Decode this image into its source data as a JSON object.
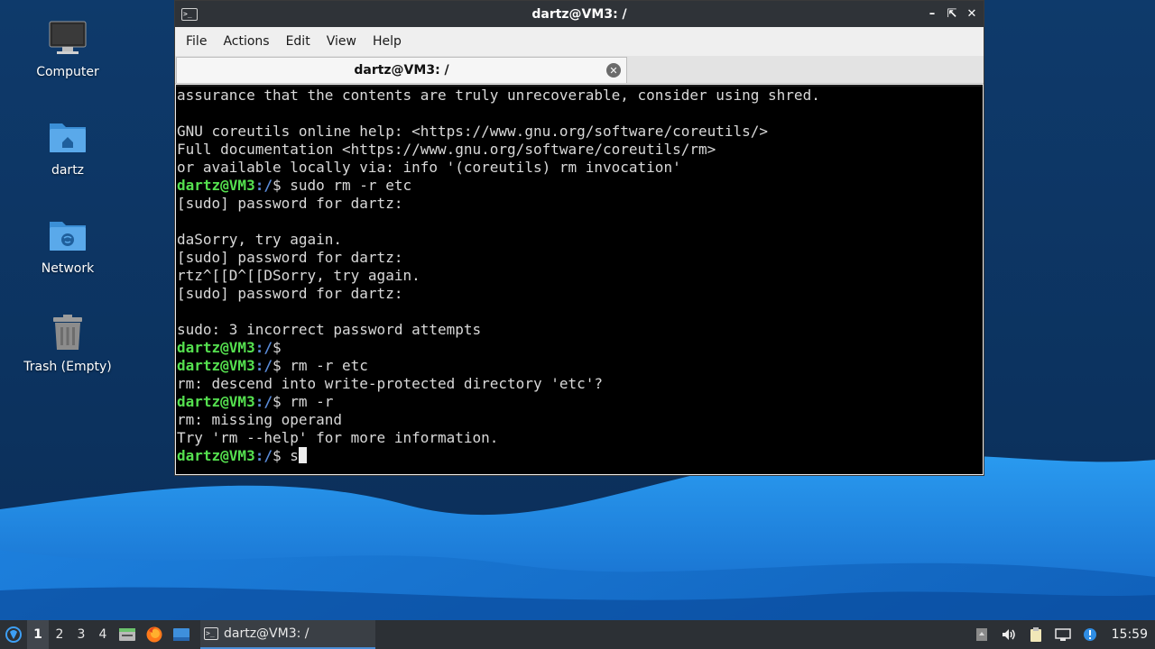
{
  "desktop": {
    "icons": [
      {
        "label": "Computer",
        "icon": "computer-icon"
      },
      {
        "label": "dartz",
        "icon": "home-folder-icon"
      },
      {
        "label": "Network",
        "icon": "network-folder-icon"
      },
      {
        "label": "Trash (Empty)",
        "icon": "trash-icon"
      }
    ]
  },
  "window": {
    "title": "dartz@VM3: /",
    "icon": "terminal-icon",
    "controls": [
      "minimize",
      "maximize",
      "close"
    ],
    "menu": [
      "File",
      "Actions",
      "Edit",
      "View",
      "Help"
    ],
    "tab": {
      "label": "dartz@VM3: /",
      "close_icon": "close-tab-icon"
    }
  },
  "terminal": {
    "prompt_user": "dartz@VM3",
    "prompt_path": ":/",
    "prompt_suffix": "$ ",
    "lines": [
      {
        "type": "out",
        "text": "assurance that the contents are truly unrecoverable, consider using shred."
      },
      {
        "type": "out",
        "text": ""
      },
      {
        "type": "out",
        "text": "GNU coreutils online help: <https://www.gnu.org/software/coreutils/>"
      },
      {
        "type": "out",
        "text": "Full documentation <https://www.gnu.org/software/coreutils/rm>"
      },
      {
        "type": "out",
        "text": "or available locally via: info '(coreutils) rm invocation'"
      },
      {
        "type": "prompt",
        "text": "sudo rm -r etc"
      },
      {
        "type": "out",
        "text": "[sudo] password for dartz:"
      },
      {
        "type": "out",
        "text": ""
      },
      {
        "type": "out",
        "text": "daSorry, try again."
      },
      {
        "type": "out",
        "text": "[sudo] password for dartz:"
      },
      {
        "type": "out",
        "text": "rtz^[[D^[[DSorry, try again."
      },
      {
        "type": "out",
        "text": "[sudo] password for dartz:"
      },
      {
        "type": "out",
        "text": ""
      },
      {
        "type": "out",
        "text": "sudo: 3 incorrect password attempts"
      },
      {
        "type": "prompt",
        "text": ""
      },
      {
        "type": "prompt",
        "text": "rm -r etc"
      },
      {
        "type": "out",
        "text": "rm: descend into write-protected directory 'etc'?"
      },
      {
        "type": "prompt",
        "text": "rm -r"
      },
      {
        "type": "out",
        "text": "rm: missing operand"
      },
      {
        "type": "out",
        "text": "Try 'rm --help' for more information."
      },
      {
        "type": "prompt",
        "text": "s",
        "cursor": true
      }
    ]
  },
  "taskbar": {
    "workspaces": [
      "1",
      "2",
      "3",
      "4"
    ],
    "active_workspace": "1",
    "launchers": [
      "file-manager-icon",
      "firefox-icon",
      "show-desktop-icon"
    ],
    "task": {
      "label": "dartz@VM3: /",
      "icon": "terminal-icon"
    },
    "tray": [
      "removable-media-icon",
      "volume-icon",
      "clipboard-icon",
      "network-icon",
      "notification-icon"
    ],
    "clock": "15:59"
  },
  "colors": {
    "prompt_user": "#55e04f",
    "prompt_path": "#5a8bd8",
    "terminal_bg": "#000000",
    "terminal_fg": "#d9d9d9",
    "titlebar_bg": "#2f3338",
    "taskbar_bg": "#2c3035",
    "wallpaper_top": "#0f3f73",
    "wallpaper_wave": "#1e86e3"
  }
}
